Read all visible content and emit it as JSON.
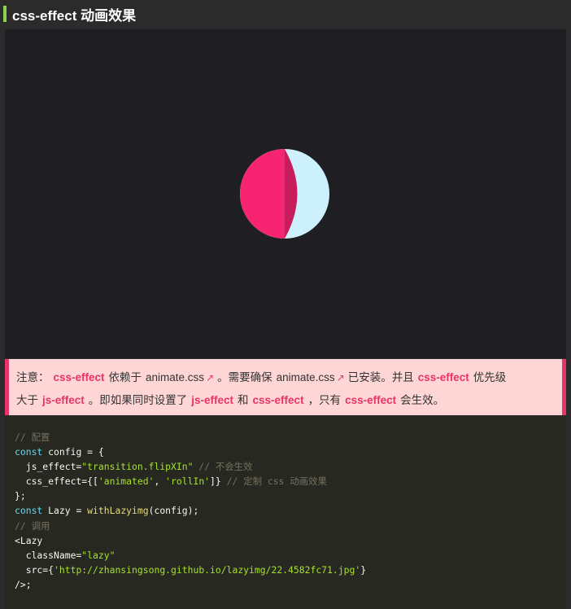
{
  "section_title": "css-effect 动画效果",
  "notice": {
    "prefix": "注意：",
    "css_effect": "css-effect",
    "depends_on": "依赖于",
    "animate_link": "animate.css",
    "link_arrow": "↗",
    "need_ensure": "。需要确保",
    "installed_and": "已安装。并且",
    "priority_higher": "优先级",
    "higher_than": "大于",
    "js_effect": "js-effect",
    "if_both": "。即如果同时设置了",
    "and_word": "和",
    "only": "，只有",
    "takes_effect": "会生效。"
  },
  "code_lines": [
    [
      {
        "t": "// 配置",
        "c": "com"
      }
    ],
    [
      {
        "t": "const",
        "c": "kw"
      },
      {
        "t": " config = {",
        "c": "txt"
      }
    ],
    [
      {
        "t": "  js_effect=",
        "c": "txt"
      },
      {
        "t": "\"transition.flipXIn\"",
        "c": "str"
      },
      {
        "t": " // 不会生效",
        "c": "com"
      }
    ],
    [
      {
        "t": "  css_effect={[",
        "c": "txt"
      },
      {
        "t": "'animated'",
        "c": "str"
      },
      {
        "t": ", ",
        "c": "txt"
      },
      {
        "t": "'rollIn'",
        "c": "str"
      },
      {
        "t": "]}",
        "c": "txt"
      },
      {
        "t": " // 定制 css 动画效果",
        "c": "com"
      }
    ],
    [
      {
        "t": "};",
        "c": "txt"
      }
    ],
    [
      {
        "t": "const",
        "c": "kw"
      },
      {
        "t": " Lazy = ",
        "c": "txt"
      },
      {
        "t": "withLazyimg",
        "c": "fn"
      },
      {
        "t": "(config);",
        "c": "txt"
      }
    ],
    [
      {
        "t": "// 调用",
        "c": "com"
      }
    ],
    [
      {
        "t": "<Lazy",
        "c": "txt"
      }
    ],
    [
      {
        "t": "  className=",
        "c": "txt"
      },
      {
        "t": "\"lazy\"",
        "c": "str"
      }
    ],
    [
      {
        "t": "  src={",
        "c": "txt"
      },
      {
        "t": "'http://zhansingsong.github.io/lazyimg/22.4582fc71.jpg'",
        "c": "str"
      },
      {
        "t": "}",
        "c": "txt"
      }
    ],
    [
      {
        "t": "/>;",
        "c": "txt"
      }
    ]
  ],
  "colors": {
    "accent_bar": "#8bd450",
    "ball_pink": "#f72571",
    "ball_dark_pink": "#c81d5c",
    "ball_light": "#cdf1fc",
    "notice_bg": "#ffd6d6",
    "notice_border": "#e8336a",
    "code_bg": "#272822"
  },
  "icons": {
    "demo_image": "rolling-ball-icon",
    "external_link": "external-link-icon"
  }
}
